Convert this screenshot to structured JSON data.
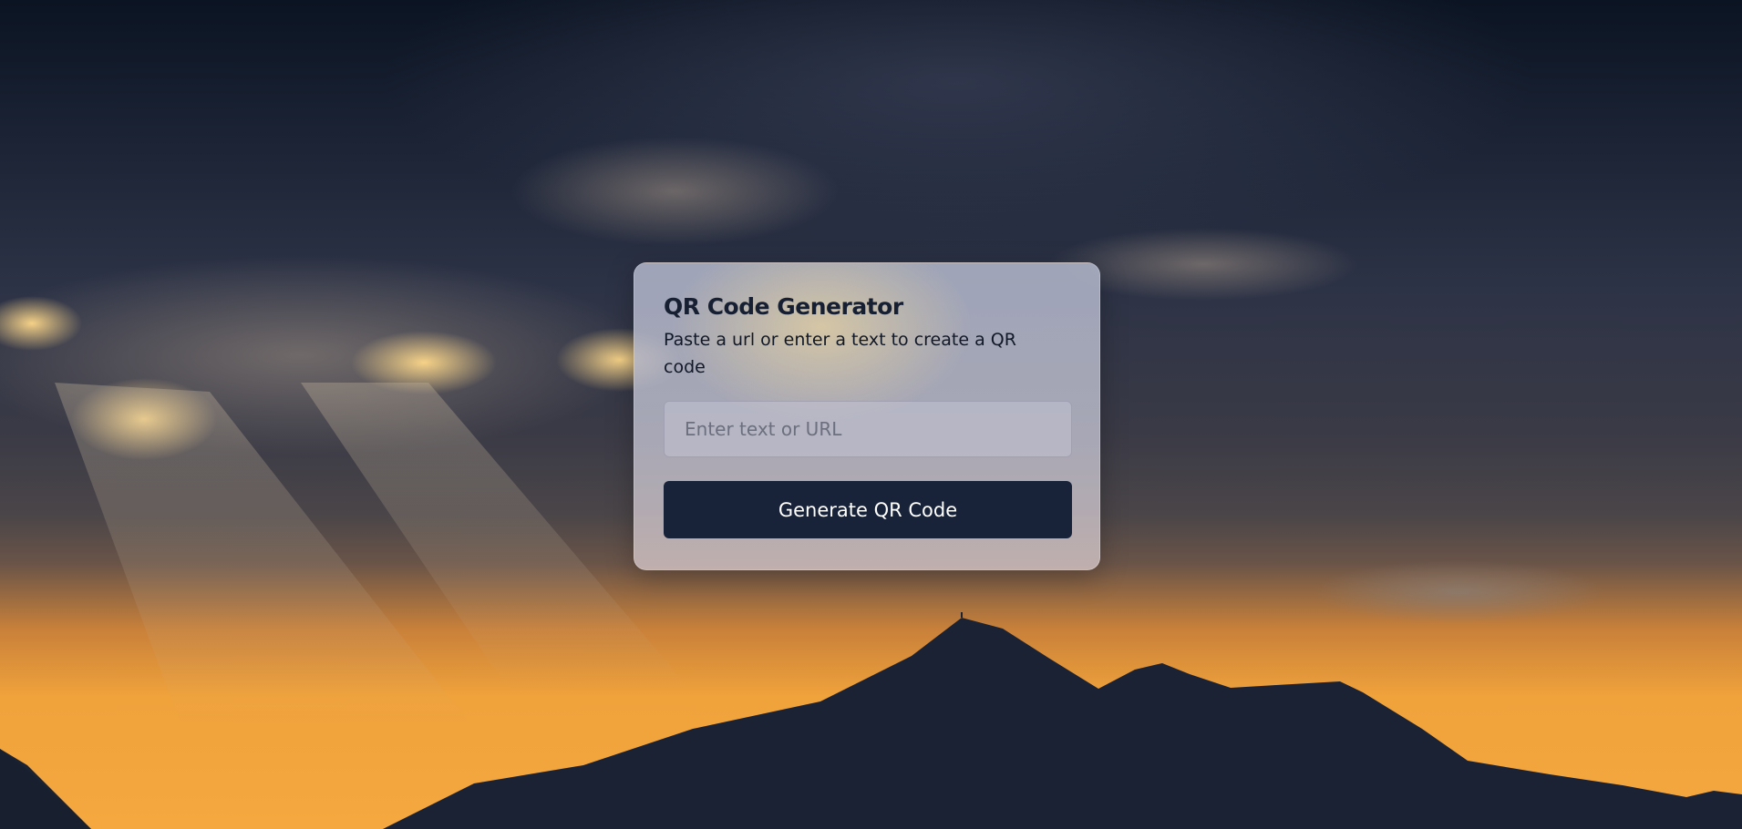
{
  "card": {
    "title": "QR Code Generator",
    "subtitle": "Paste a url or enter a text to create a QR code",
    "input_placeholder": "Enter text or URL",
    "input_value": "",
    "button_label": "Generate QR Code"
  },
  "colors": {
    "button_bg": "#18233a",
    "title_text": "#172033",
    "sunset_orange": "#f5a83f",
    "sky_dark": "#1c2436"
  }
}
